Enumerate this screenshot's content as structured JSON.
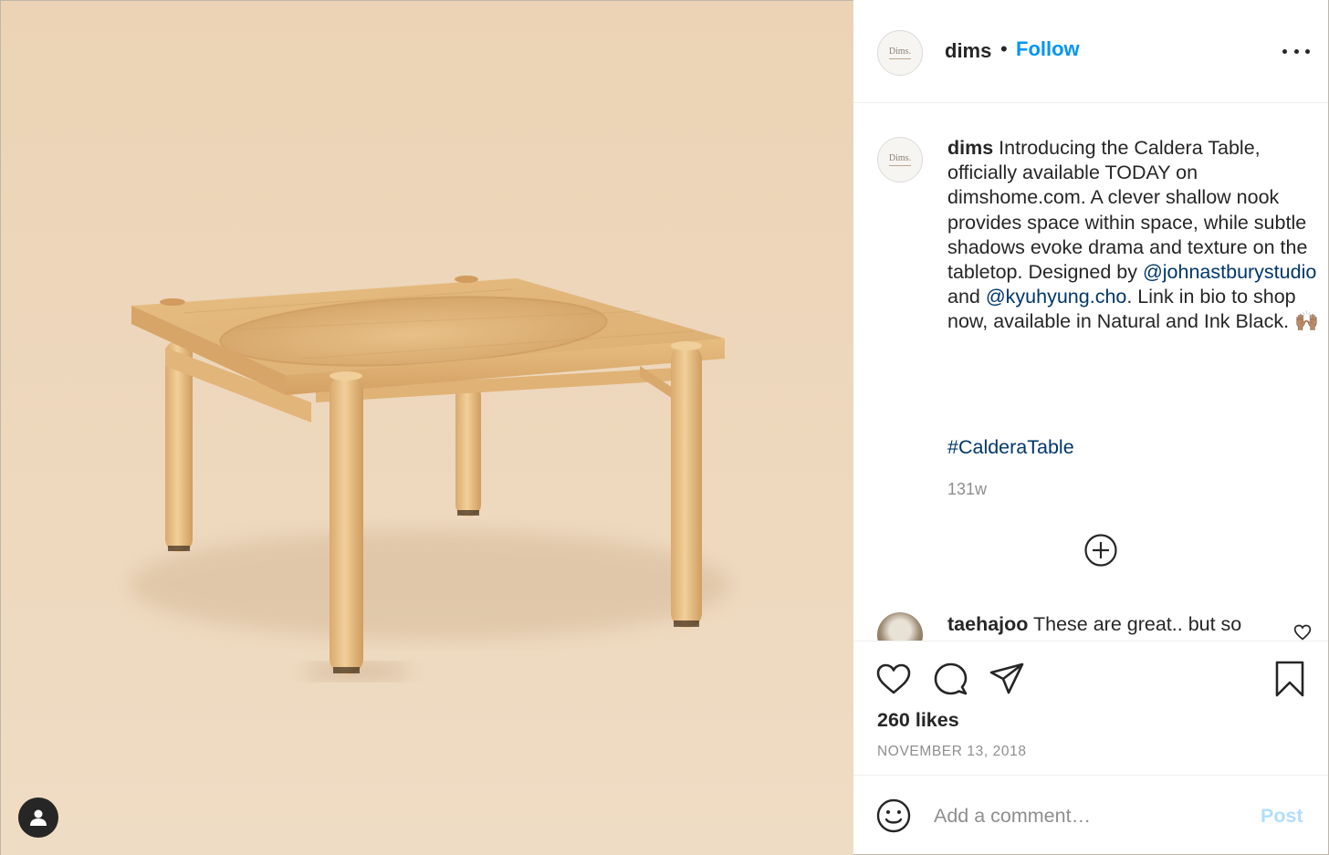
{
  "post": {
    "username": "dims",
    "avatar_logo_text": "Dims.",
    "follow_separator": "•",
    "follow_label": "Follow",
    "more_icon": "more-horizontal-icon"
  },
  "caption": {
    "username": "dims",
    "text_1": " Introducing the Caldera Table, officially available TODAY on dimshome.com. A clever shallow nook provides space within space, while subtle shadows evoke drama and texture on the tabletop. Designed by ",
    "mention_1": "@johnastburystudio",
    "text_2": " and ",
    "mention_2": "@kyuhyung.cho",
    "text_3": ". Link in bio to shop now, available in Natural and Ink Black. 🙌🏽",
    "hashtag": "#CalderaTable",
    "age": "131w"
  },
  "comment": {
    "username": "taehajoo",
    "text": " These are great.. but so"
  },
  "actions": {
    "likes": "260 likes",
    "date": "NOVEMBER 13, 2018"
  },
  "composer": {
    "placeholder": "Add a comment…",
    "post_label": "Post"
  },
  "colors": {
    "accent": "#0095f6",
    "link": "#00376b",
    "media_background": "#ecd4b7",
    "post_disabled": "#b2dffc"
  }
}
